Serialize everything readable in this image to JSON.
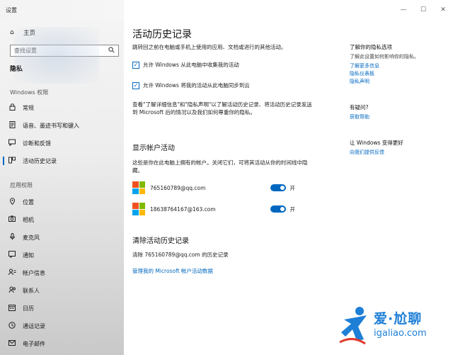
{
  "window": {
    "title": "设置",
    "minimize_glyph": "—",
    "maximize_glyph": "☐",
    "close_glyph": "✕"
  },
  "sidebar": {
    "home": {
      "label": "主页",
      "icon": "home-icon"
    },
    "search": {
      "placeholder": "查找设置",
      "icon": "search-icon"
    },
    "privacy_header": "隐私",
    "windows_section": "Windows 权限",
    "windows_items": [
      {
        "label": "常规",
        "icon": "lock-icon"
      },
      {
        "label": "语音、墨迹书写和键入",
        "icon": "notepad-icon"
      },
      {
        "label": "诊断和反馈",
        "icon": "feedback-icon"
      },
      {
        "label": "活动历史记录",
        "icon": "history-icon",
        "active": true
      }
    ],
    "app_section": "应用权限",
    "app_items": [
      {
        "label": "位置",
        "icon": "location-icon"
      },
      {
        "label": "相机",
        "icon": "camera-icon"
      },
      {
        "label": "麦克风",
        "icon": "microphone-icon"
      },
      {
        "label": "通知",
        "icon": "notification-icon"
      },
      {
        "label": "帐户信息",
        "icon": "account-info-icon"
      },
      {
        "label": "联系人",
        "icon": "contacts-icon"
      },
      {
        "label": "日历",
        "icon": "calendar-icon"
      },
      {
        "label": "通话记录",
        "icon": "call-history-icon"
      },
      {
        "label": "电子邮件",
        "icon": "email-icon"
      }
    ]
  },
  "main": {
    "title": "活动历史记录",
    "description": "跳转回之前在电脑或手机上使用的应用、文档或进行的其他活动。",
    "checkbox1": {
      "label": "允许 Windows 从此电脑中收集我的活动",
      "checked": true
    },
    "checkbox2": {
      "label": "允许 Windows 将我的活动从此电脑同步到云",
      "checked": true
    },
    "info": "查看\"了解详细信息\"和\"隐私声明\"以了解活动历史记录、将活动历史记录发送到 Microsoft 后的情况以及我们如何尊重你的隐私。",
    "accounts_title": "显示帐户活动",
    "accounts_desc": "这些是你在此电脑上拥有的帐户。关闭它们，可将其活动从你的时间线中隐藏。",
    "accounts": [
      {
        "email": "765160789@qq.com",
        "toggle_label": "开",
        "on": true
      },
      {
        "email": "18638764167@163.com",
        "toggle_label": "开",
        "on": true
      }
    ],
    "clear_title": "清除活动历史记录",
    "clear_desc": "清除 765160789@qq.com 的历史记录",
    "manage_link": "管理我的 Microsoft 帐户活动数据"
  },
  "right": {
    "privacy_options_title": "了解你的隐私选项",
    "privacy_options_desc": "了解此设置如何影响你的隐私。",
    "links": [
      "了解更多信息",
      "隐私仪表板",
      "隐私声明"
    ],
    "question_title": "有疑问?",
    "help_link": "获取帮助",
    "improve_title": "让 Windows 变得更好",
    "feedback_link": "向我们提供反馈"
  },
  "watermark": {
    "cn": "爱·尬聊",
    "en": "igaliao.com"
  },
  "colors": {
    "accent": "#0067c0",
    "ms_red": "#f25022",
    "ms_green": "#7fba00",
    "ms_blue": "#00a4ef",
    "ms_yellow": "#ffb900",
    "watermark": "#1e7fd6"
  }
}
